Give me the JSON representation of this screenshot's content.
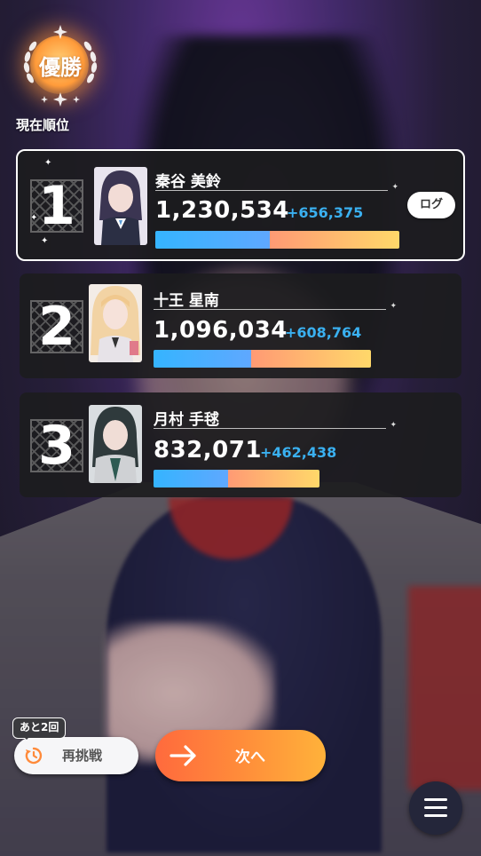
{
  "badge": {
    "title": "優勝"
  },
  "rank_label": "現在順位",
  "ranking": [
    {
      "rank": "1",
      "name": "秦谷 美鈴",
      "score": "1,230,534",
      "diff": "+656,375",
      "bar_blue_fraction": 0.47,
      "bar_length_fraction": 1.0
    },
    {
      "rank": "2",
      "name": "十王 星南",
      "score": "1,096,034",
      "diff": "+608,764",
      "bar_blue_fraction": 0.45,
      "bar_length_fraction": 0.89
    },
    {
      "rank": "3",
      "name": "月村 手毬",
      "score": "832,071",
      "diff": "+462,438",
      "bar_blue_fraction": 0.45,
      "bar_length_fraction": 0.68
    }
  ],
  "log_button": "ログ",
  "retry": {
    "label": "再挑戦",
    "remaining": "あと2回"
  },
  "next_button": "次へ",
  "colors": {
    "accent_orange": "#ff8c3a",
    "diff_blue": "#3ab0f0",
    "bar_blue": "#35b4ff"
  },
  "icons": {
    "retry": "timer-refresh-icon",
    "next": "arrow-right-icon",
    "menu": "hamburger-menu-icon"
  }
}
